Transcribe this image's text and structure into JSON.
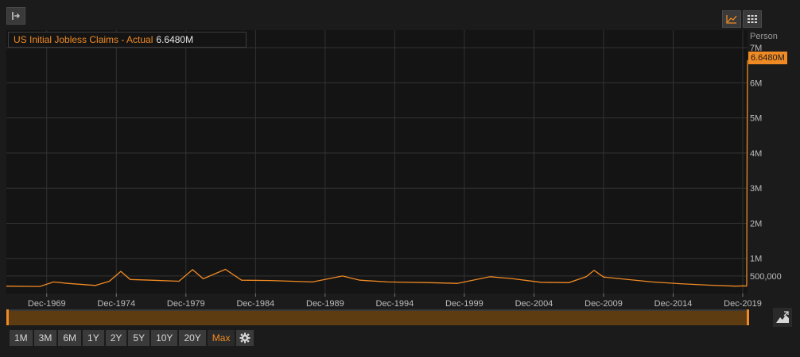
{
  "legend": {
    "series_name": "US Initial Jobless Claims - Actual",
    "value": "6.6480M"
  },
  "axis_unit": "Person",
  "last_value_tag": "6.6480M",
  "period_buttons": [
    "1M",
    "3M",
    "6M",
    "1Y",
    "2Y",
    "5Y",
    "10Y",
    "20Y",
    "Max"
  ],
  "active_period": "Max",
  "colors": {
    "series": "#f08a24",
    "plot_bg": "#141414",
    "grid": "#333333",
    "page_bg": "#1b1b1b"
  },
  "icons": [
    "collapse-panel-icon",
    "chart-type-icon",
    "table-view-icon",
    "zoom-chart-icon",
    "gear-icon"
  ],
  "chart_data": {
    "type": "line",
    "title": "",
    "xlabel": "",
    "ylabel": "Person",
    "x_tick_labels": [
      "Dec-1969",
      "Dec-1974",
      "Dec-1979",
      "Dec-1984",
      "Dec-1989",
      "Dec-1994",
      "Dec-1999",
      "Dec-2004",
      "Dec-2009",
      "Dec-2014",
      "Dec-2019"
    ],
    "y_tick_labels": [
      "500,000",
      "1M",
      "2M",
      "3M",
      "4M",
      "5M",
      "6M",
      "7M"
    ],
    "y_ticks": [
      500000,
      1000000,
      2000000,
      3000000,
      4000000,
      5000000,
      6000000,
      7000000
    ],
    "ylim": [
      0,
      7500000
    ],
    "xlim": [
      "1967-01-07",
      "2020-04-04"
    ],
    "grid": true,
    "series": [
      {
        "name": "US Initial Jobless Claims - Actual",
        "x": [
          "1967-01-07",
          "1969-06-01",
          "1970-06-01",
          "1971-06-01",
          "1973-06-01",
          "1974-06-01",
          "1975-03-29",
          "1975-12-01",
          "1977-06-01",
          "1979-06-01",
          "1980-05-24",
          "1981-03-01",
          "1982-10-02",
          "1983-12-01",
          "1986-01-01",
          "1989-01-01",
          "1991-03-01",
          "1992-06-01",
          "1994-06-01",
          "1997-06-01",
          "1999-06-01",
          "2001-10-06",
          "2003-04-01",
          "2005-06-01",
          "2007-06-01",
          "2008-09-01",
          "2009-03-28",
          "2009-12-01",
          "2011-06-01",
          "2013-06-01",
          "2015-06-01",
          "2017-06-01",
          "2019-06-01",
          "2020-01-04",
          "2020-03-07",
          "2020-03-14",
          "2020-03-21",
          "2020-03-28",
          "2020-04-04"
        ],
        "values": [
          210000,
          200000,
          330000,
          290000,
          230000,
          350000,
          630000,
          400000,
          380000,
          350000,
          680000,
          420000,
          690000,
          380000,
          370000,
          330000,
          500000,
          380000,
          330000,
          310000,
          290000,
          480000,
          430000,
          320000,
          310000,
          480000,
          660000,
          470000,
          410000,
          330000,
          280000,
          240000,
          210000,
          220000,
          210000,
          250000,
          2900000,
          5500000,
          6648000
        ]
      }
    ]
  }
}
